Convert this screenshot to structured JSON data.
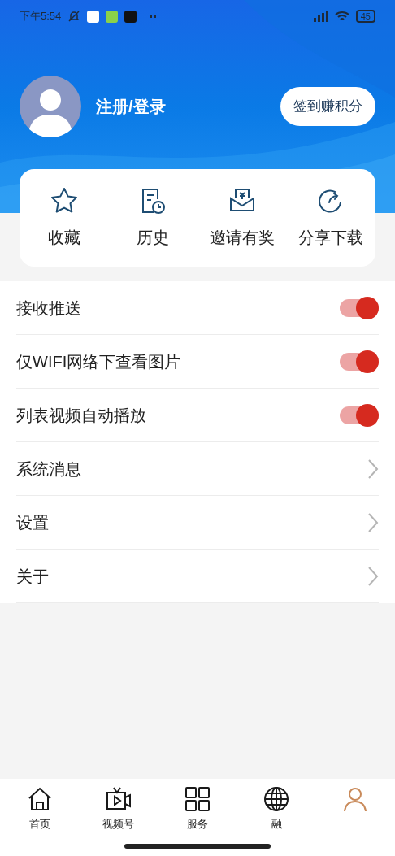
{
  "status_bar": {
    "time": "下午5:54",
    "battery": "45"
  },
  "profile": {
    "login": "注册/登录",
    "checkin_button": "签到赚积分"
  },
  "shortcuts": [
    {
      "kind": "star",
      "label": "收藏"
    },
    {
      "kind": "history",
      "label": "历史"
    },
    {
      "kind": "invite",
      "label": "邀请有奖"
    },
    {
      "kind": "share",
      "label": "分享下载"
    }
  ],
  "settings": [
    {
      "kind": "toggle",
      "label": "接收推送",
      "on": true
    },
    {
      "kind": "toggle",
      "label": "仅WIFI网络下查看图片",
      "on": true
    },
    {
      "kind": "toggle",
      "label": "列表视频自动播放",
      "on": true
    },
    {
      "kind": "link",
      "label": "系统消息"
    },
    {
      "kind": "link",
      "label": "设置"
    },
    {
      "kind": "link",
      "label": "关于"
    }
  ],
  "bottom_nav": [
    {
      "kind": "home",
      "label": "首页",
      "selected": false
    },
    {
      "kind": "video",
      "label": "视频号",
      "selected": false
    },
    {
      "kind": "grid",
      "label": "服务",
      "selected": false
    },
    {
      "kind": "globe",
      "label": "融",
      "selected": false
    },
    {
      "kind": "person",
      "selected": true
    }
  ]
}
